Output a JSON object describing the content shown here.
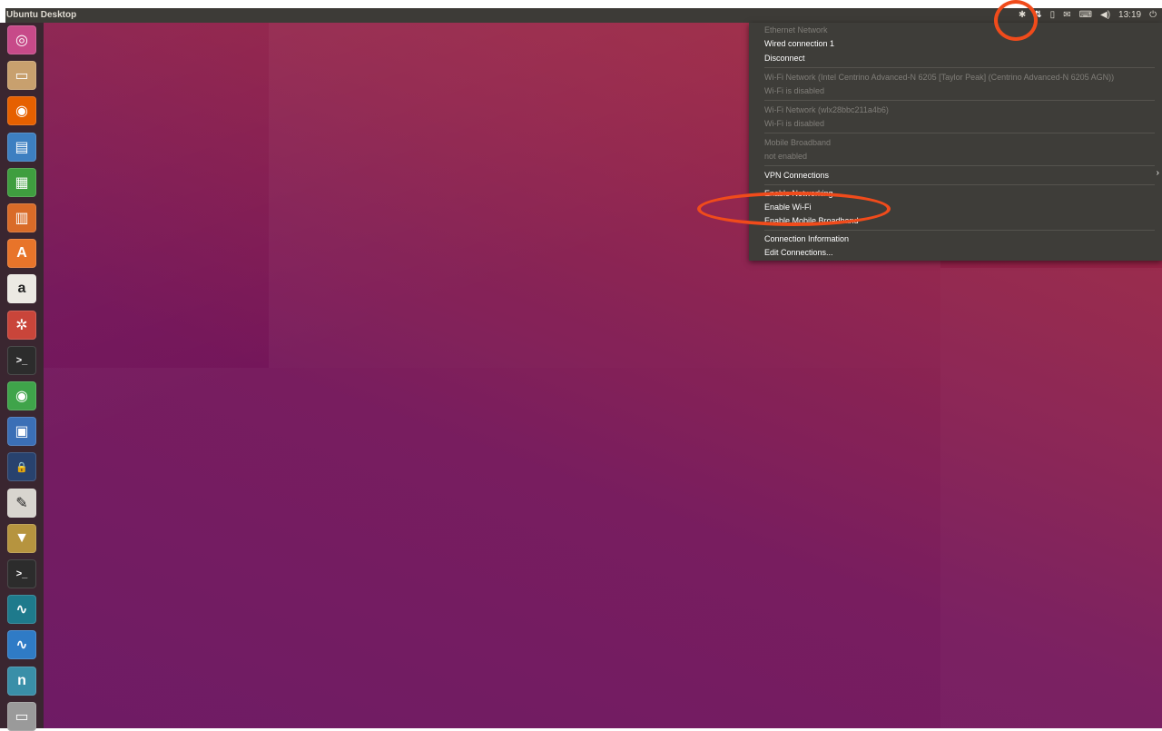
{
  "panel": {
    "title": "Ubuntu Desktop",
    "tray": {
      "bluetooth_glyph": "✱",
      "network_glyph": "⇅",
      "battery_glyph": "▯",
      "mail_glyph": "✉",
      "keyboard_glyph": "⌨",
      "volume_glyph": "◀)",
      "clock": "13:19",
      "power_glyph": "⏻"
    }
  },
  "launcher": {
    "items": [
      {
        "name": "dash-home-icon",
        "glyph": "◎",
        "color": "#c74a89"
      },
      {
        "name": "files-icon",
        "glyph": "▭",
        "color": "#c8a06e"
      },
      {
        "name": "firefox-icon",
        "glyph": "◉",
        "color": "#e66000"
      },
      {
        "name": "writer-icon",
        "glyph": "▤",
        "color": "#3d7fc1"
      },
      {
        "name": "calc-icon",
        "glyph": "▦",
        "color": "#3f9e3f"
      },
      {
        "name": "impress-icon",
        "glyph": "▥",
        "color": "#d96b28"
      },
      {
        "name": "software-center-icon",
        "glyph": "A",
        "color": "#e8742a"
      },
      {
        "name": "amazon-icon",
        "glyph": "a",
        "color": "#ece9e3"
      },
      {
        "name": "system-settings-icon",
        "glyph": "✲",
        "color": "#c9453a"
      },
      {
        "name": "terminal-icon",
        "glyph": ">_",
        "color": "#2c2c2c"
      },
      {
        "name": "chrome-icon",
        "glyph": "◉",
        "color": "#3fa44a"
      },
      {
        "name": "virtualbox-icon",
        "glyph": "▣",
        "color": "#3b6fb6"
      },
      {
        "name": "vpn-lock-icon",
        "glyph": "🔒",
        "color": "#28426e"
      },
      {
        "name": "text-editor-icon",
        "glyph": "✎",
        "color": "#d8d5cf"
      },
      {
        "name": "archive-manager-icon",
        "glyph": "▼",
        "color": "#b6943f"
      },
      {
        "name": "terminal-2-icon",
        "glyph": ">_",
        "color": "#2c2c2c"
      },
      {
        "name": "oscilloscope-icon",
        "glyph": "∿",
        "color": "#1e7a8c"
      },
      {
        "name": "monitor-icon",
        "glyph": "∿",
        "color": "#2f7bc6"
      },
      {
        "name": "nautilus-n-icon",
        "glyph": "n",
        "color": "#3a8fa8"
      },
      {
        "name": "trash-icon",
        "glyph": "▭",
        "color": "#9a9a9a"
      }
    ]
  },
  "network_menu": {
    "ethernet_header": "Ethernet Network",
    "wired_connection": "Wired connection 1",
    "disconnect": "Disconnect",
    "wifi_network_1": "Wi-Fi Network (Intel Centrino Advanced-N 6205 [Taylor Peak] (Centrino Advanced-N 6205 AGN))",
    "wifi_disabled_1": "Wi-Fi is disabled",
    "wifi_network_2": "Wi-Fi Network (wlx28bbc211a4b6)",
    "wifi_disabled_2": "Wi-Fi is disabled",
    "mobile_broadband": "Mobile Broadband",
    "not_enabled": "not enabled",
    "vpn_connections": "VPN Connections",
    "vpn_arrow": "›",
    "enable_networking": "Enable Networking",
    "enable_wifi": "Enable Wi-Fi",
    "enable_mobile_broadband": "Enable Mobile Broadband",
    "connection_information": "Connection Information",
    "edit_connections": "Edit Connections..."
  },
  "annotation_color": "#f04b1b"
}
